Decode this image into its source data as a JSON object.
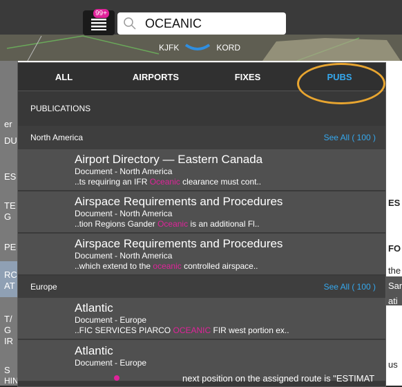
{
  "header": {
    "badge": "99+",
    "search_value": "OCEANIC",
    "route_from": "KJFK",
    "route_to": "KORD"
  },
  "tabs": [
    {
      "label": "ALL"
    },
    {
      "label": "AIRPORTS"
    },
    {
      "label": "FIXES"
    },
    {
      "label": "PUBS",
      "active": true
    }
  ],
  "publications_heading": "PUBLICATIONS",
  "sections": [
    {
      "name": "North America",
      "see_all": "See All ( 100 )",
      "items": [
        {
          "title": "Airport Directory — Eastern Canada",
          "subtitle": "Document - North America",
          "snippet_before": "..ts requiring an IFR ",
          "snippet_hl": "Oceanic",
          "snippet_after": " clearance must cont.."
        },
        {
          "title": "Airspace Requirements and Procedures",
          "subtitle": "Document - North America",
          "snippet_before": "..tion Regions Gander ",
          "snippet_hl": "Oceanic",
          "snippet_after": " is an additional Fl.."
        },
        {
          "title": "Airspace Requirements and Procedures",
          "subtitle": "Document - North America",
          "snippet_before": "..which extend to the ",
          "snippet_hl": "oceanic",
          "snippet_after": " controlled airspace.."
        }
      ]
    },
    {
      "name": "Europe",
      "see_all": "See All ( 100 )",
      "items": [
        {
          "title": "Atlantic",
          "subtitle": "Document - Europe",
          "snippet_before": "..FIC SERVICES PIARCO ",
          "snippet_hl": "OCEANIC",
          "snippet_after": " FIR west portion ex.."
        },
        {
          "title": "Atlantic",
          "subtitle": "Document - Europe",
          "snippet_before": "",
          "snippet_hl": "",
          "snippet_after": ""
        }
      ]
    }
  ],
  "background_text": {
    "footer": "next position on the assigned route is \"ESTIMAT",
    "left_fragments": [
      "er",
      "DU",
      "ES",
      "TE",
      "G",
      "PE",
      "RC",
      "AT",
      "T/",
      "G",
      "IR",
      "S",
      "HIN NAT"
    ],
    "right_fragments": [
      "ES",
      "FO",
      "the",
      "San",
      "ati",
      "us"
    ]
  },
  "colors": {
    "accent_blue": "#35a8ee",
    "highlight_magenta": "#e0239a",
    "annotation_orange": "#e8a530",
    "panel_bg": "#383838"
  },
  "icons": {
    "menu": "menu-list-icon",
    "search": "search-icon",
    "route": "route-chevron-icon"
  }
}
